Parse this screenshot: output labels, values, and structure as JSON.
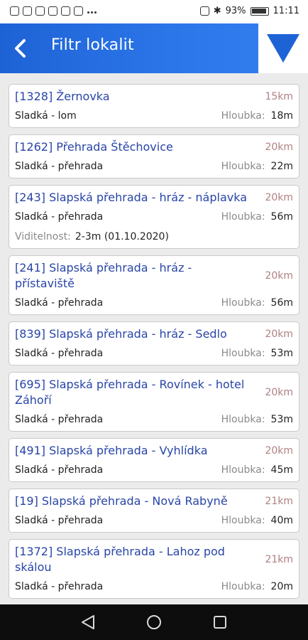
{
  "status_bar": {
    "battery": "93%",
    "time": "11:11"
  },
  "app_bar": {
    "title": "Filtr lokalit"
  },
  "locations": [
    {
      "name": "[1328] Žernovka",
      "distance": "15km",
      "owner": "Sladká - lom",
      "depth_label": "Hloubka:",
      "depth": "18m"
    },
    {
      "name": "[1262] Přehrada Štěchovice",
      "distance": "20km",
      "owner": "Sladká - přehrada",
      "depth_label": "Hloubka:",
      "depth": "22m"
    },
    {
      "name": "[243] Slapská přehrada - hráz - náplavka",
      "distance": "20km",
      "owner": "Sladká - přehrada",
      "depth_label": "Hloubka:",
      "depth": "56m",
      "visibility_label": "Viditelnost:",
      "visibility": "2-3m (01.10.2020)"
    },
    {
      "name": "[241] Slapská přehrada - hráz - přístaviště",
      "distance": "20km",
      "owner": "Sladká - přehrada",
      "depth_label": "Hloubka:",
      "depth": "56m"
    },
    {
      "name": "[839] Slapská přehrada - hráz - Sedlo",
      "distance": "20km",
      "owner": "Sladká - přehrada",
      "depth_label": "Hloubka:",
      "depth": "53m"
    },
    {
      "name": "[695] Slapská přehrada - Rovínek - hotel Záhoří",
      "distance": "20km",
      "owner": "Sladká - přehrada",
      "depth_label": "Hloubka:",
      "depth": "53m"
    },
    {
      "name": "[491] Slapská přehrada - Vyhlídka",
      "distance": "20km",
      "owner": "Sladká - přehrada",
      "depth_label": "Hloubka:",
      "depth": "45m"
    },
    {
      "name": "[19] Slapská přehrada - Nová Rabyně",
      "distance": "21km",
      "owner": "Sladká - přehrada",
      "depth_label": "Hloubka:",
      "depth": "40m"
    },
    {
      "name": "[1372] Slapská přehrada - Lahoz pod skálou",
      "distance": "21km",
      "owner": "Sladká - přehrada",
      "depth_label": "Hloubka:",
      "depth": "20m"
    }
  ],
  "colors": {
    "app_bar": "#2c77ea",
    "filter_triangle": "#1e63d6",
    "location_name": "#2845a8",
    "distance": "#b08080"
  },
  "icons": {
    "back": "back-arrow-icon",
    "filter": "filter-triangle-icon",
    "nav_back": "nav-back-icon",
    "nav_home": "nav-home-icon",
    "nav_recents": "nav-recents-icon"
  }
}
